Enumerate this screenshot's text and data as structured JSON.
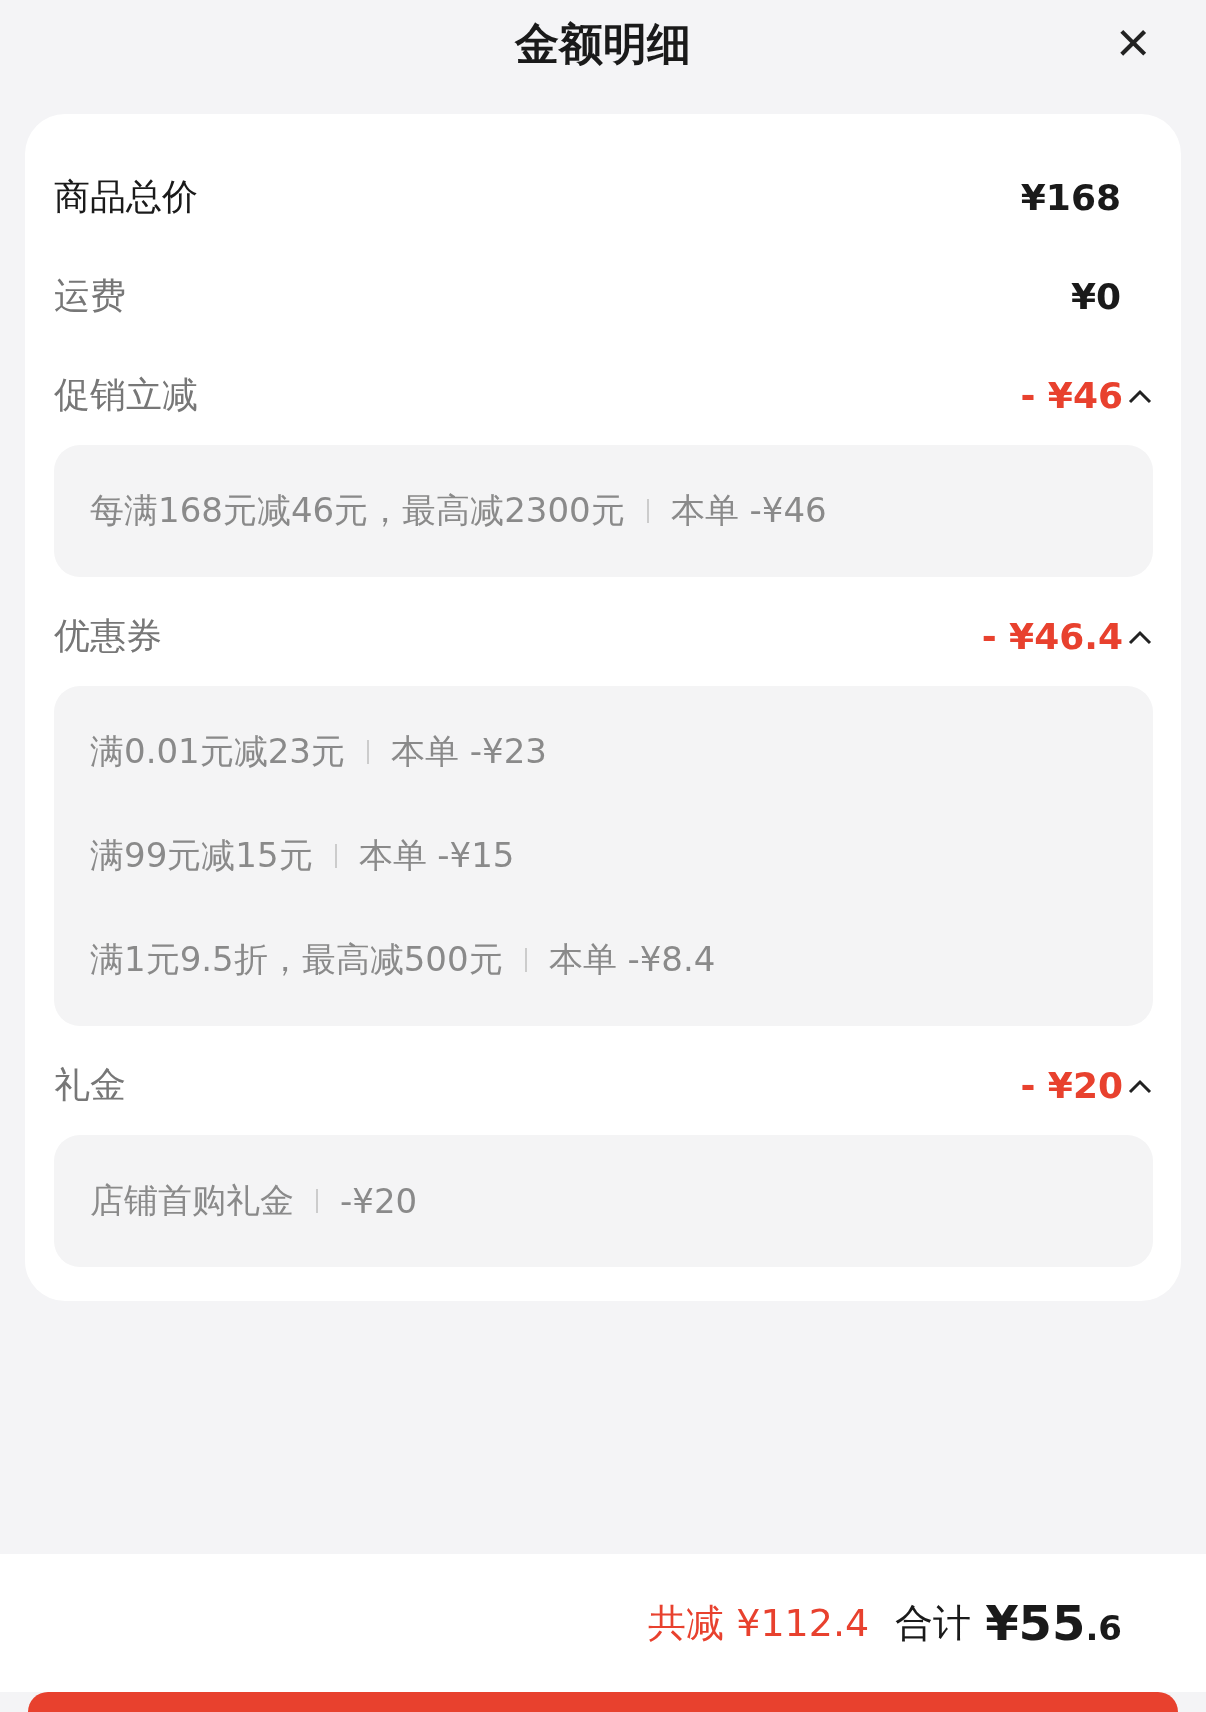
{
  "header": {
    "title": "金额明细",
    "close": "×"
  },
  "rows": [
    {
      "kind": "total",
      "label": "商品总价",
      "amount": "¥168"
    },
    {
      "kind": "plain",
      "label": "运费",
      "amount": "¥0"
    },
    {
      "kind": "discount",
      "label": "促销立减",
      "amount": "- ¥46",
      "expanded": true,
      "details": [
        {
          "text": "每满168元减46元，最高减2300元",
          "amount": "本单 -¥46"
        }
      ]
    },
    {
      "kind": "discount",
      "label": "优惠券",
      "amount": "- ¥46.4",
      "expanded": true,
      "details": [
        {
          "text": "满0.01元减23元",
          "amount": "本单 -¥23"
        },
        {
          "text": "满99元减15元",
          "amount": "本单 -¥15"
        },
        {
          "text": "满1元9.5折，最高减500元",
          "amount": "本单 -¥8.4"
        }
      ]
    },
    {
      "kind": "discount",
      "label": "礼金",
      "amount": "- ¥20",
      "expanded": true,
      "details": [
        {
          "text": "店铺首购礼金",
          "amount": "-¥20"
        }
      ]
    }
  ],
  "footer": {
    "saved": "共减 ¥112.4",
    "total_label": "合计",
    "total": "¥55.6"
  }
}
